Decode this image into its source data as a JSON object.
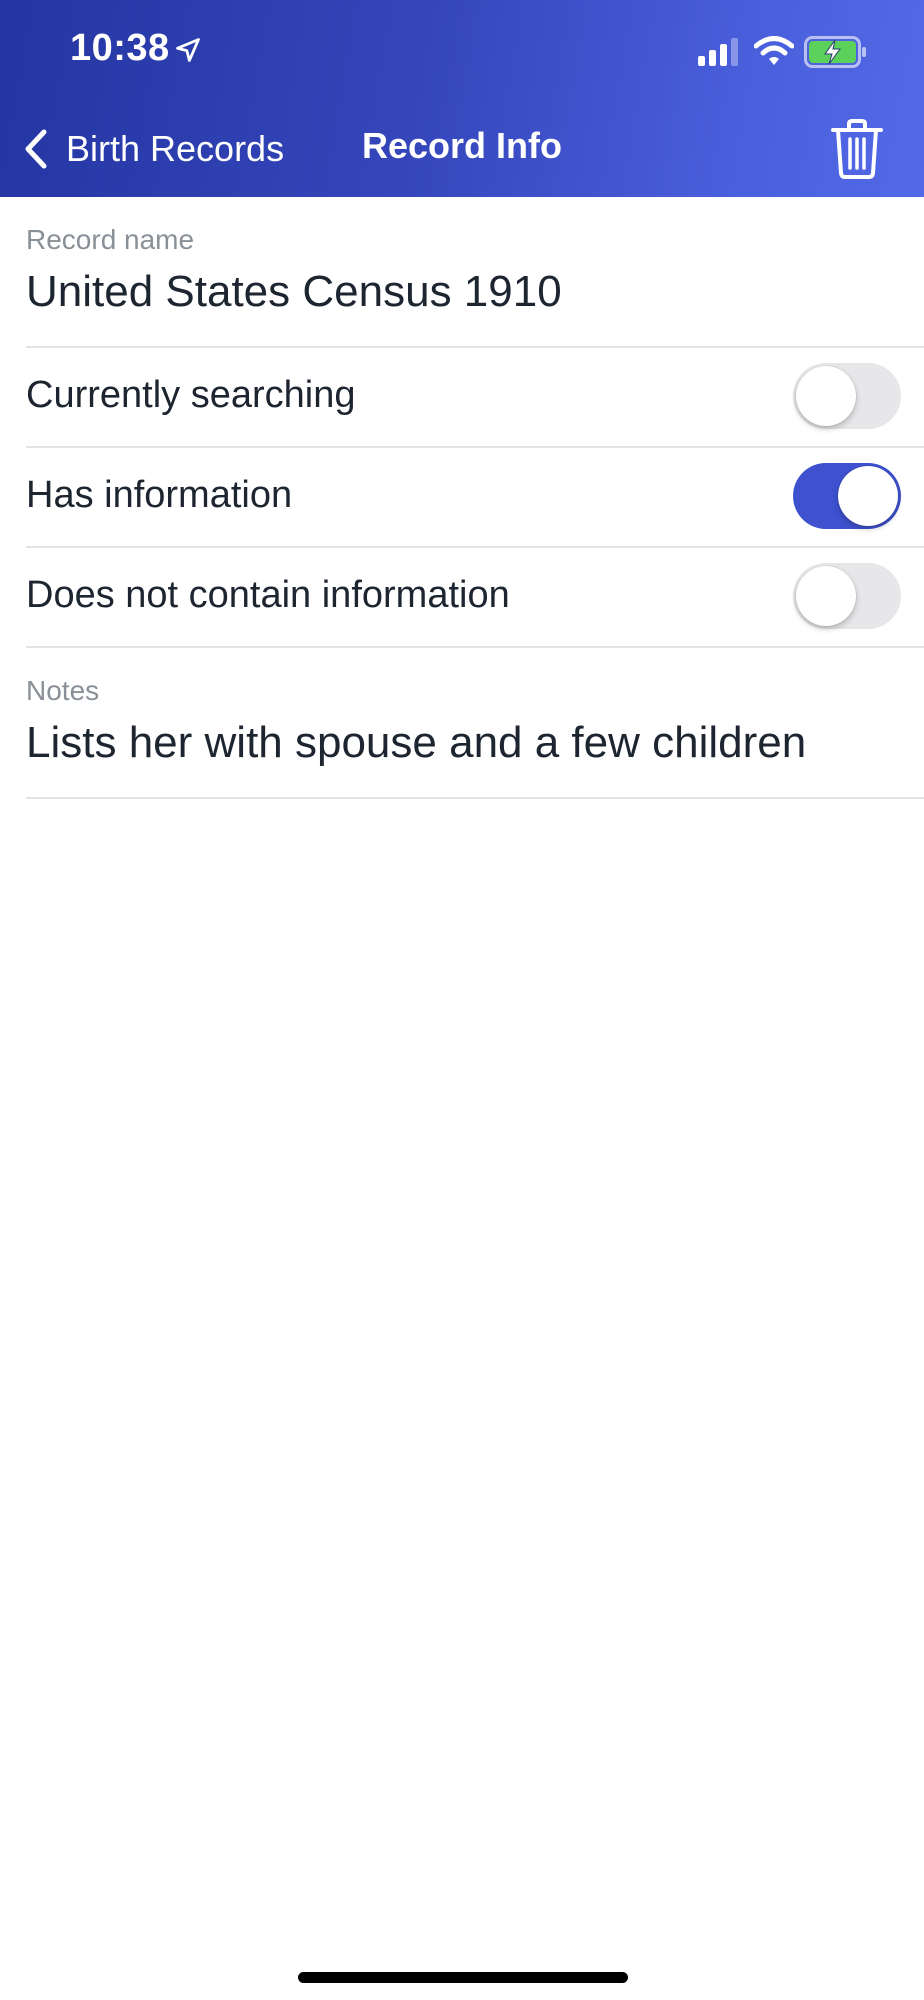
{
  "status_bar": {
    "time": "10:38",
    "icons": [
      "location-arrow-icon",
      "cellular-signal-icon",
      "wifi-icon",
      "battery-charging-icon"
    ],
    "battery_color": "#5bd05a"
  },
  "nav": {
    "back_label": "Birth Records",
    "title": "Record Info",
    "delete_icon": "trash-icon",
    "gradient_colors": [
      "#2436a2",
      "#5369e6"
    ]
  },
  "record": {
    "name_label": "Record name",
    "name_value": "United States Census 1910",
    "toggles": [
      {
        "label": "Currently searching",
        "on": false
      },
      {
        "label": "Has information",
        "on": true
      },
      {
        "label": "Does not contain information",
        "on": false
      }
    ],
    "notes_label": "Notes",
    "notes_value": "Lists her with spouse and a few children"
  },
  "colors": {
    "accent": "#3e51cf",
    "toggle_off": "#e7e7e9",
    "separator": "#e1e3e6",
    "label_gray": "#8a9097"
  }
}
